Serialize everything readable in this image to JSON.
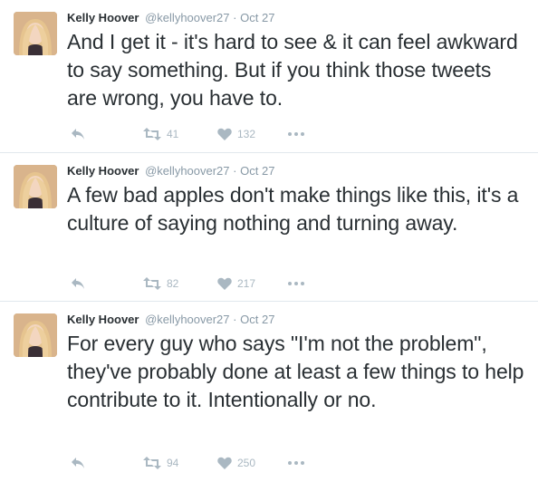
{
  "tweets": [
    {
      "fullname": "Kelly Hoover",
      "username": "@kellyhoover27",
      "separator": "·",
      "time": "Oct 27",
      "text": "And I get it - it's hard to see & it can feel awkward to say something. But if you think those tweets are wrong, you have to.",
      "retweets": "41",
      "likes": "132"
    },
    {
      "fullname": "Kelly Hoover",
      "username": "@kellyhoover27",
      "separator": "·",
      "time": "Oct 27",
      "text": "A few bad apples don't make things like this, it's a culture of saying nothing and turning away.",
      "retweets": "82",
      "likes": "217"
    },
    {
      "fullname": "Kelly Hoover",
      "username": "@kellyhoover27",
      "separator": "·",
      "time": "Oct 27",
      "text": "For every guy who says \"I'm not the problem\", they've probably done at least a few things to help contribute to it. Intentionally or no.",
      "retweets": "94",
      "likes": "250"
    }
  ],
  "icons": {
    "reply": "reply-icon",
    "retweet": "retweet-icon",
    "like": "heart-icon",
    "more": "more-icon"
  },
  "colors": {
    "text": "#292f33",
    "muted": "#8899a6",
    "action_icon": "#aab8c2",
    "divider": "#e1e8ed"
  }
}
